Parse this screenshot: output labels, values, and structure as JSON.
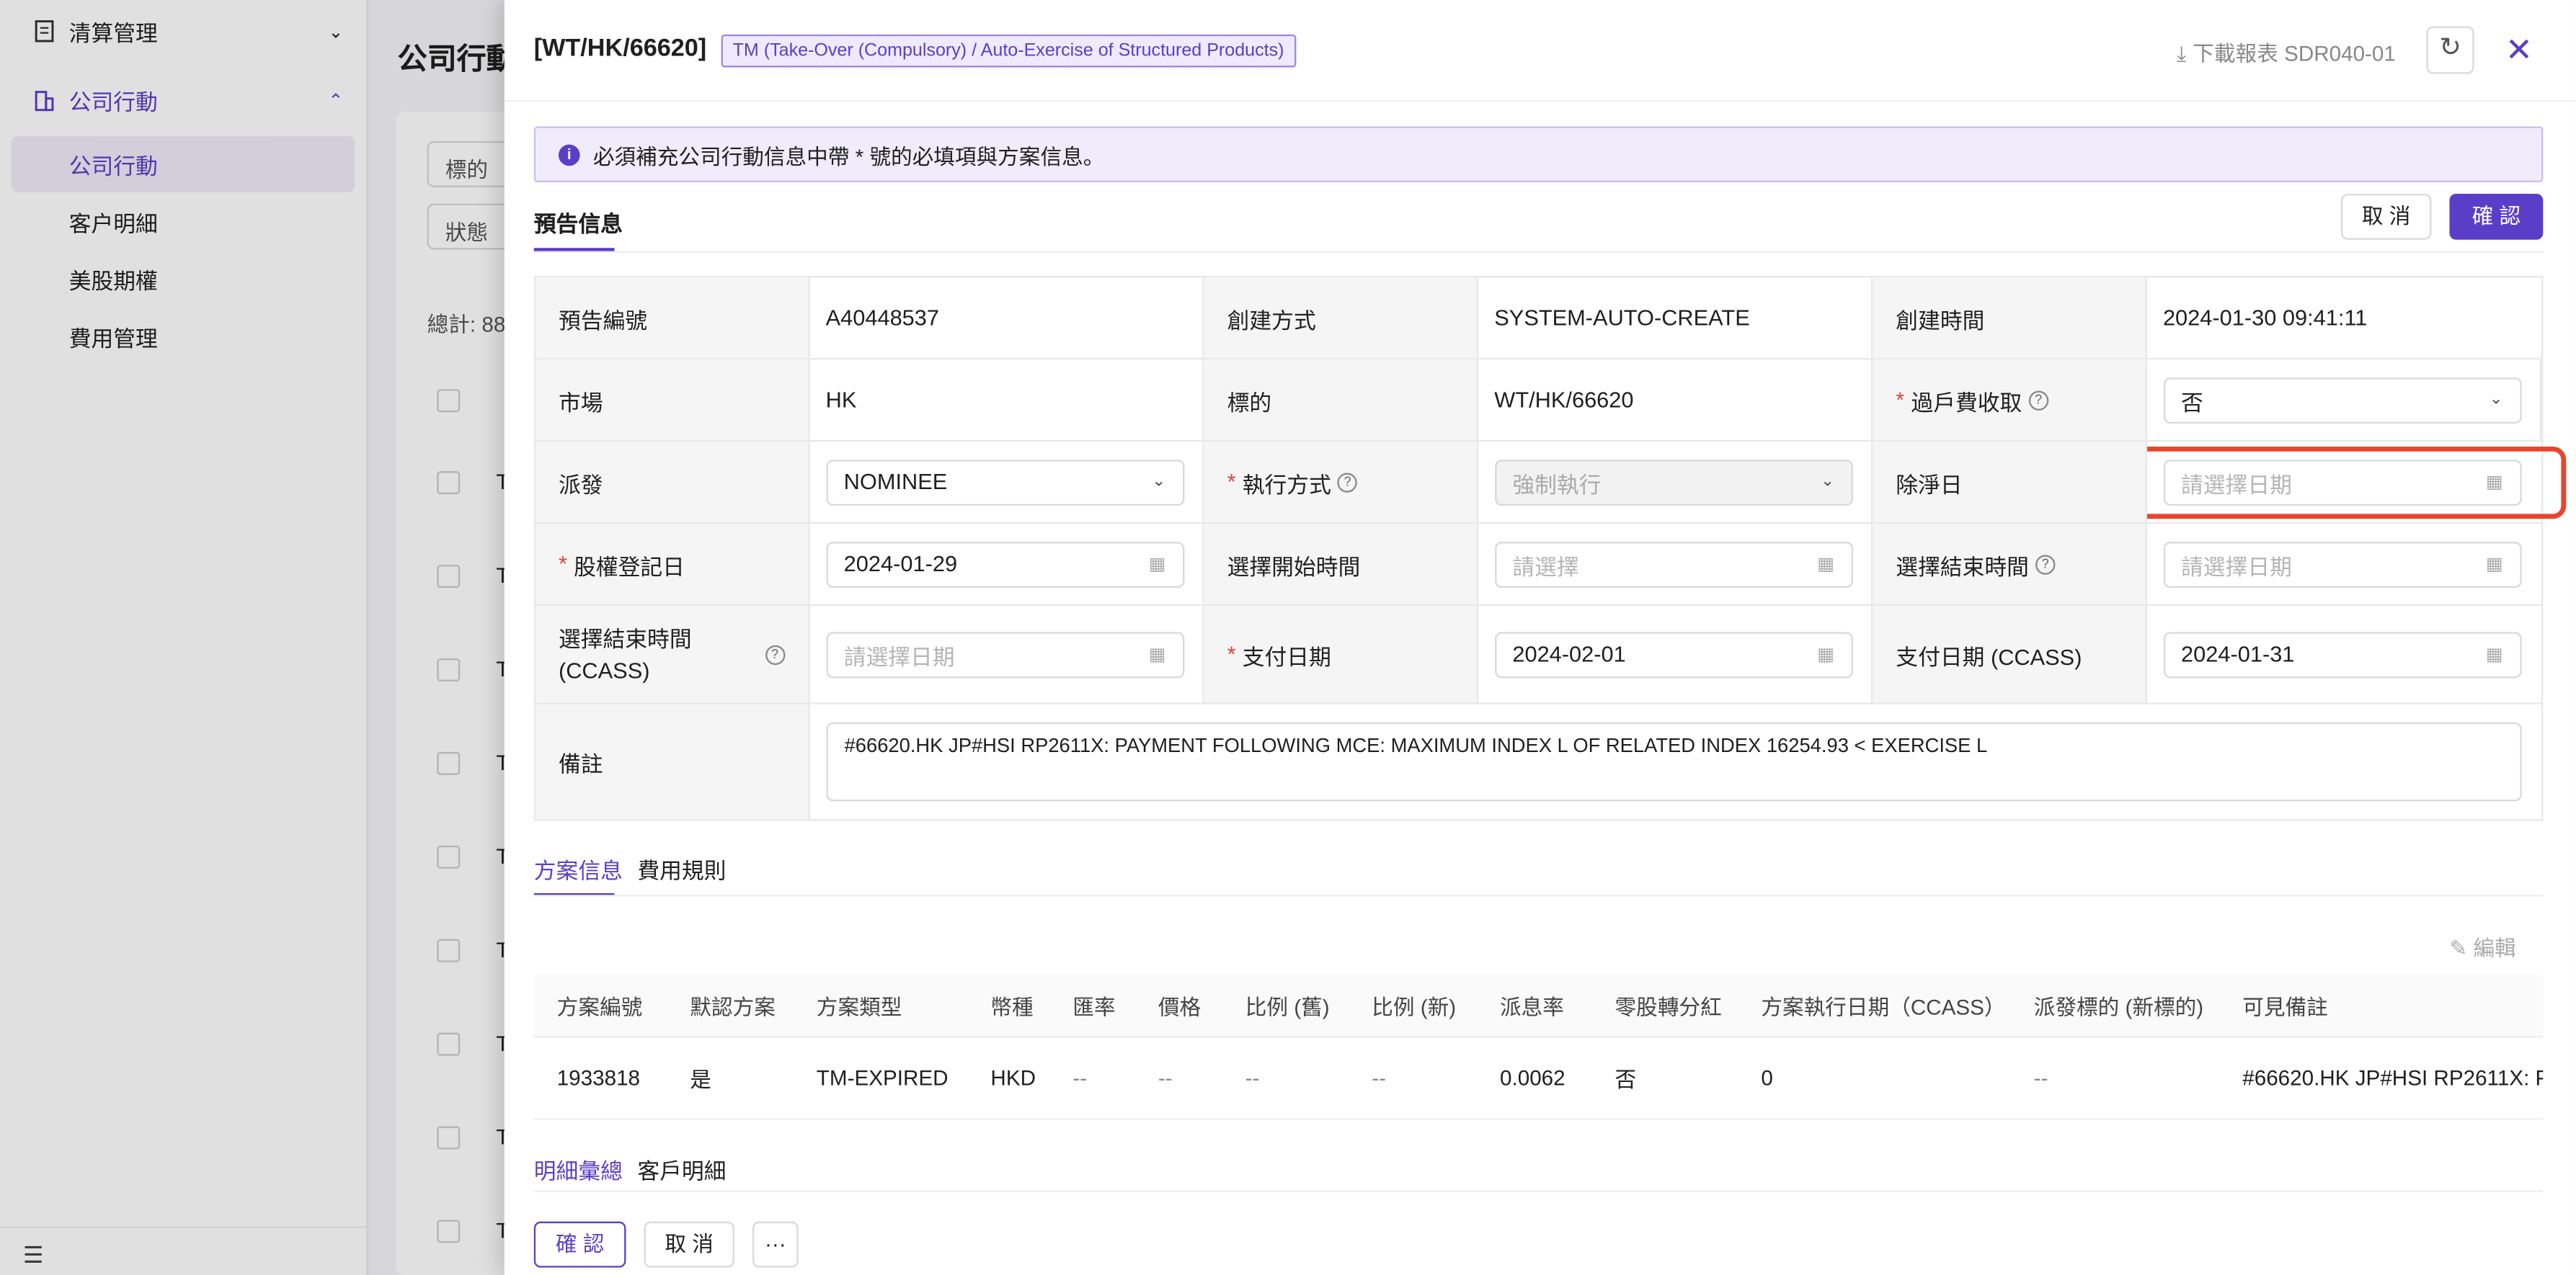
{
  "sidebar": {
    "group1_label": "清算管理",
    "group2_label": "公司行動",
    "items": [
      "公司行動",
      "客户明細",
      "美股期權",
      "費用管理"
    ]
  },
  "background": {
    "page_title": "公司行動",
    "filter1": "標的",
    "filter2": "狀態",
    "total": "總計: 88",
    "row_prefix": "T"
  },
  "drawer": {
    "title": "[WT/HK/66620]",
    "tag": "TM (Take-Over (Compulsory) / Auto-Exercise of Structured Products)",
    "download_label": "下載報表 SDR040-01",
    "alert": "必須補充公司行動信息中帶 * 號的必填項與方案信息。",
    "section_tab": "預告信息",
    "cancel_label": "取 消",
    "confirm_label": "確 認",
    "form": {
      "notice_no_label": "預告編號",
      "notice_no": "A40448537",
      "create_method_label": "創建方式",
      "create_method": "SYSTEM-AUTO-CREATE",
      "create_time_label": "創建時間",
      "create_time": "2024-01-30 09:41:11",
      "market_label": "市場",
      "market": "HK",
      "underlying_label": "標的",
      "underlying": "WT/HK/66620",
      "transfer_fee_label": "過戶費收取",
      "transfer_fee": "否",
      "distribution_label": "派發",
      "distribution": "NOMINEE",
      "exec_method_label": "執行方式",
      "exec_method": "強制執行",
      "ex_date_label": "除淨日",
      "date_placeholder": "請選擇日期",
      "record_date_label": "股權登記日",
      "record_date": "2024-01-29",
      "select_start_label": "選擇開始時間",
      "select_placeholder": "請選擇",
      "select_end_label": "選擇結束時間",
      "select_end_ccass_label": "選擇結束時間 (CCASS)",
      "pay_date_label": "支付日期",
      "pay_date": "2024-02-01",
      "pay_date_ccass_label": "支付日期 (CCASS)",
      "pay_date_ccass": "2024-01-31",
      "remark_label": "備註",
      "remark": "#66620.HK JP#HSI RP2611X: PAYMENT FOLLOWING MCE: MAXIMUM INDEX L  OF RELATED INDEX 16254.93 < EXERCISE L"
    },
    "plan_tabs": [
      "方案信息",
      "費用規則"
    ],
    "edit_label": "編輯",
    "plan_columns": [
      "方案編號",
      "默認方案",
      "方案類型",
      "幣種",
      "匯率",
      "價格",
      "比例 (舊)",
      "比例 (新)",
      "派息率",
      "零股轉分紅",
      "方案執行日期（CCASS）",
      "派發標的 (新標的)",
      "可見備註"
    ],
    "plan_row": [
      "1933818",
      "是",
      "TM-EXPIRED",
      "HKD",
      "--",
      "--",
      "--",
      "--",
      "0.0062",
      "否",
      "0",
      "--",
      "#66620.HK JP#HSI RP2611X: P"
    ],
    "detail_tabs": [
      "明細彙總",
      "客戶明細"
    ],
    "footer_confirm": "確 認",
    "footer_cancel": "取 消",
    "footer_more": "···"
  }
}
